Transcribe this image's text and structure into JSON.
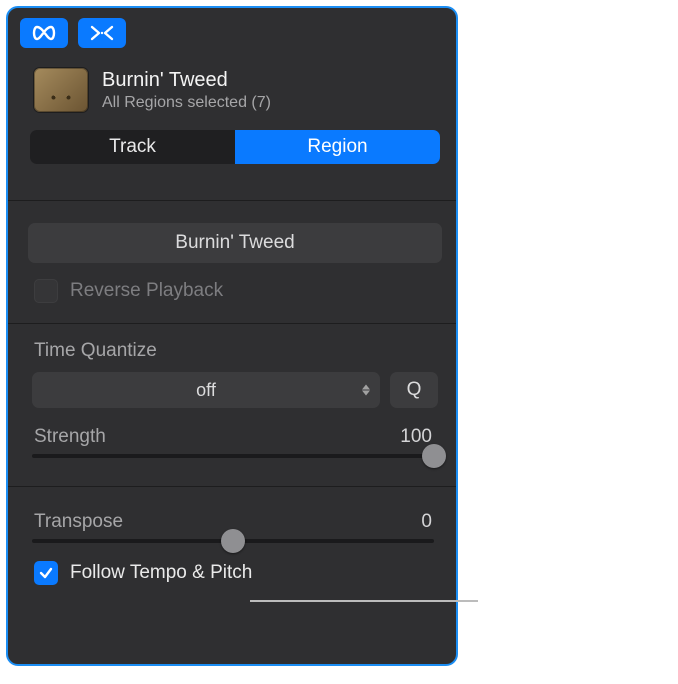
{
  "header": {
    "title": "Burnin' Tweed",
    "subtitle": "All Regions selected (7)"
  },
  "segmented": {
    "track_label": "Track",
    "region_label": "Region",
    "active": "region"
  },
  "region": {
    "name_field": "Burnin' Tweed",
    "reverse_playback_label": "Reverse Playback",
    "reverse_playback_checked": false
  },
  "time_quantize": {
    "label": "Time Quantize",
    "select_value": "off",
    "q_button": "Q",
    "strength_label": "Strength",
    "strength_value": "100",
    "strength_percent": 100
  },
  "transpose": {
    "label": "Transpose",
    "value": "0",
    "percent": 50
  },
  "follow": {
    "label": "Follow Tempo & Pitch",
    "checked": true
  },
  "icons": {
    "loop": "loop-icon",
    "merge": "merge-arrows-icon"
  }
}
